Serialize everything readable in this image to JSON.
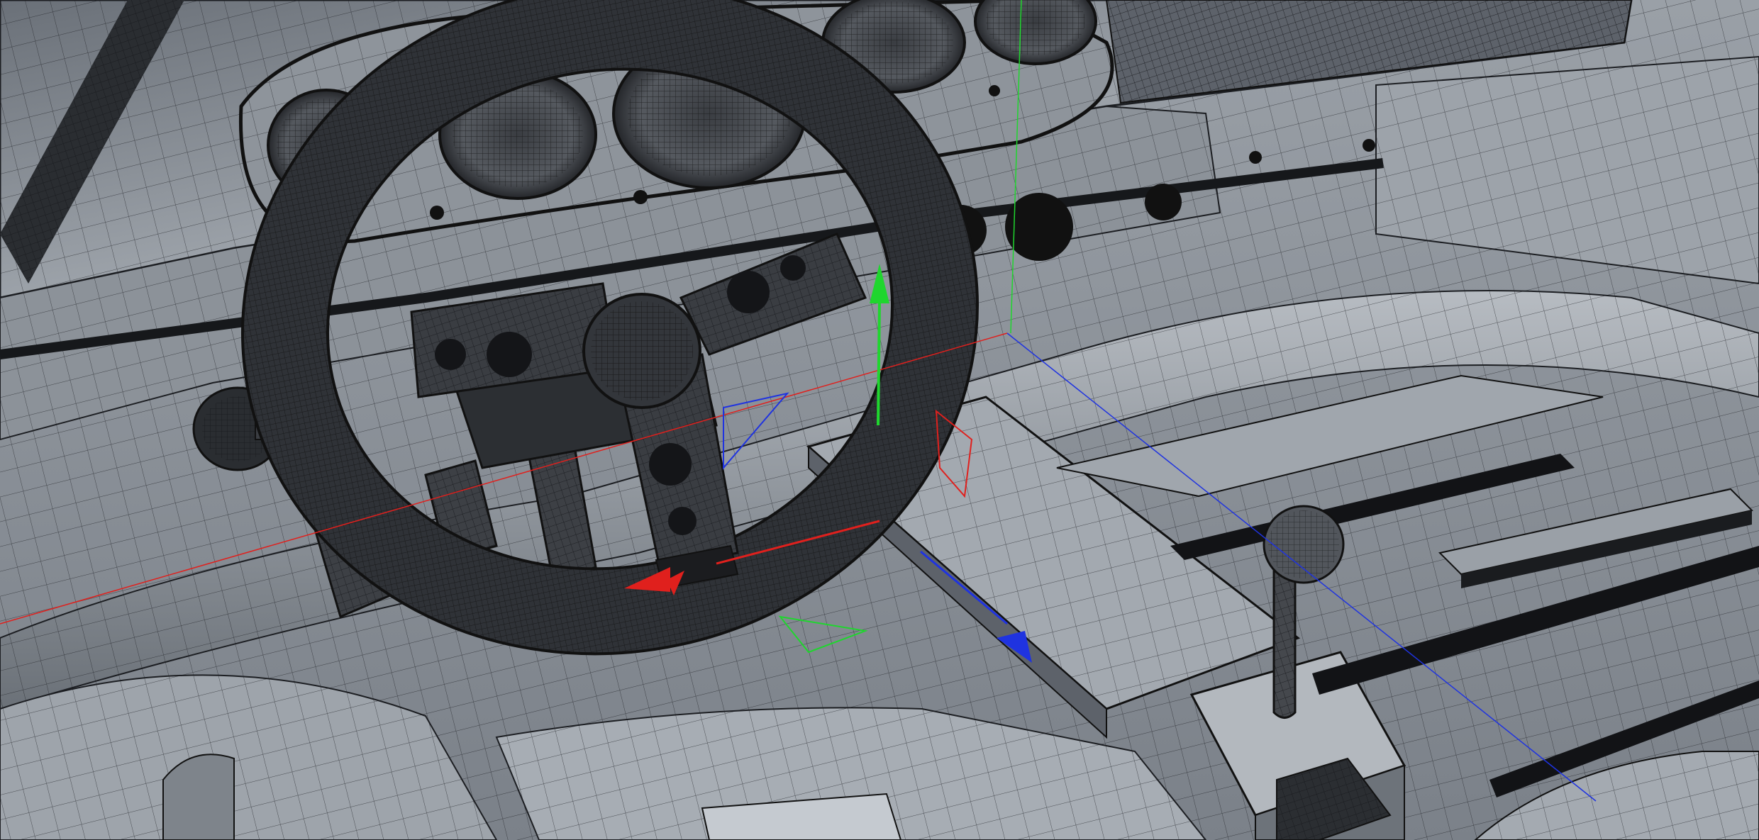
{
  "viewport": {
    "mode": "wireframe-on-shaded",
    "background_color": "#8b9097",
    "wire_color": "#1c1e22",
    "shade_light": "#a8adb4",
    "shade_mid": "#8a9097",
    "shade_dark": "#5d626a"
  },
  "gizmo": {
    "type": "move-transform",
    "axis_colors": {
      "x": "#e0201d",
      "y": "#1fd62e",
      "z": "#1f33e0"
    },
    "plane_handles": [
      "xy-plane",
      "yz-plane",
      "xz-plane"
    ]
  },
  "scene": {
    "objects": [
      "dashboard",
      "instrument-cluster",
      "gauge",
      "steering-wheel",
      "pedal",
      "gear-shifter",
      "center-console",
      "floor-panel",
      "seat",
      "door-panel"
    ]
  }
}
